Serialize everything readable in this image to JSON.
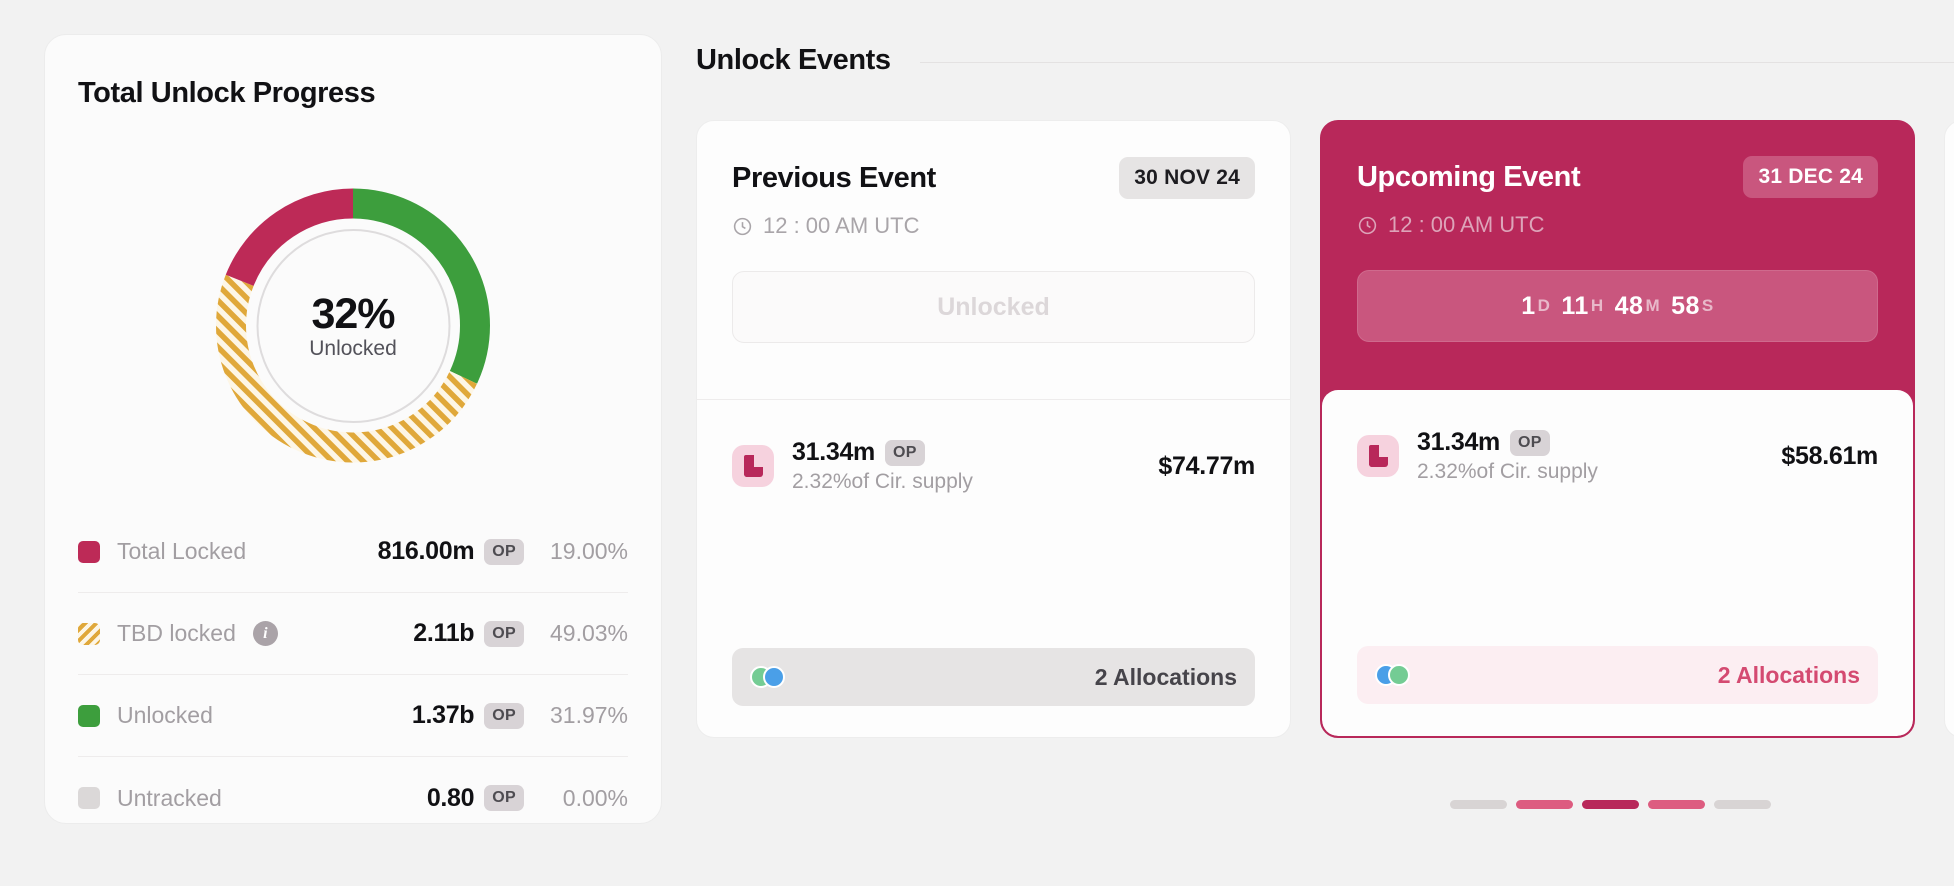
{
  "progress": {
    "title": "Total Unlock Progress",
    "donut": {
      "center_value": "32%",
      "center_label": "Unlocked"
    },
    "legend": [
      {
        "label": "Total Locked",
        "value": "816.00m",
        "token": "OP",
        "percent": "19.00%",
        "color": "#bd2a57",
        "style": "solid",
        "info": false
      },
      {
        "label": "TBD locked",
        "value": "2.11b",
        "token": "OP",
        "percent": "49.03%",
        "color": "#e0a83a",
        "style": "hatch",
        "info": true,
        "info_icon": "info-icon"
      },
      {
        "label": "Unlocked",
        "value": "1.37b",
        "token": "OP",
        "percent": "31.97%",
        "color": "#3d9e3d",
        "style": "solid",
        "info": false
      },
      {
        "label": "Untracked",
        "value": "0.80",
        "token": "OP",
        "percent": "0.00%",
        "color": "#dbd8d8",
        "style": "solid",
        "info": false
      }
    ]
  },
  "chart_data": {
    "type": "pie",
    "title": "Total Unlock Progress",
    "center_text": "32% Unlocked",
    "categories": [
      "Unlocked",
      "TBD locked",
      "Total Locked"
    ],
    "values": [
      31.97,
      49.03,
      19.0
    ],
    "raw_amounts": [
      "1.37b OP",
      "2.11b OP",
      "816.00m OP"
    ],
    "colors": [
      "#3d9e3d",
      "#e0a83a",
      "#bd2a57"
    ],
    "legend_position": "bottom",
    "grid": false,
    "notes": "Donut starts at 12 o'clock clockwise: Unlocked green 31.97%, TBD locked hatched gold 49.03%, Total Locked crimson 19.00%; Untracked 0.00% not rendered"
  },
  "events": {
    "section_title": "Unlock Events",
    "cards": [
      {
        "name": "Previous Event",
        "date": "30 NOV 24",
        "clock_icon": "clock-icon",
        "time": "12 : 00 AM UTC",
        "status": "Unlocked",
        "allocation": {
          "icon": "op-token-icon",
          "amount": "31.34m",
          "token": "OP",
          "supply": "2.32%of Cir. supply",
          "usd": "$74.77m"
        },
        "footer": {
          "count": "2 Allocations",
          "avatars": [
            "#74cc94",
            "#4a9fe8"
          ]
        }
      },
      {
        "name": "Upcoming Event",
        "date": "31 DEC 24",
        "clock_icon": "clock-icon",
        "time": "12 : 00 AM UTC",
        "countdown": {
          "days": "1",
          "days_unit": "D",
          "hours": "11",
          "hours_unit": "H",
          "minutes": "48",
          "minutes_unit": "M",
          "seconds": "58",
          "seconds_unit": "S"
        },
        "allocation": {
          "icon": "op-token-icon",
          "amount": "31.34m",
          "token": "OP",
          "supply": "2.32%of Cir. supply",
          "usd": "$58.61m"
        },
        "footer": {
          "count": "2 Allocations",
          "avatars": [
            "#4a9fe8",
            "#74cc94"
          ]
        }
      }
    ],
    "pagination": [
      {
        "color": "#d8d4d4",
        "active": false
      },
      {
        "color": "#dd5c80",
        "active": false
      },
      {
        "color": "#b8285a",
        "active": true
      },
      {
        "color": "#dd5c80",
        "active": false
      },
      {
        "color": "#d8d4d4",
        "active": false
      }
    ]
  },
  "colors": {
    "accent": "#b8285a",
    "locked": "#bd2a57",
    "tbd": "#e0a83a",
    "unlocked": "#3d9e3d",
    "untracked": "#dbd8d8"
  }
}
